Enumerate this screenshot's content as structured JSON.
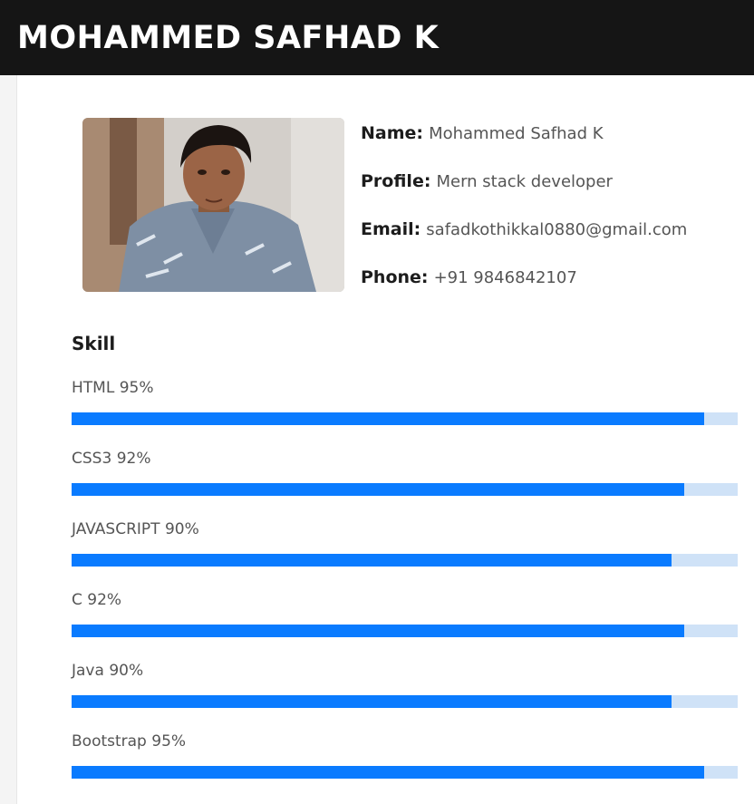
{
  "header": {
    "title": "MOHAMMED SAFHAD K"
  },
  "profile": {
    "photo_alt": "profile photo",
    "fields": [
      {
        "key": "Name:",
        "value": "Mohammed Safhad K"
      },
      {
        "key": "Profile:",
        "value": "Mern stack developer"
      },
      {
        "key": "Email:",
        "value": "safadkothikkal0880@gmail.com"
      },
      {
        "key": "Phone:",
        "value": "+91 9846842107"
      }
    ]
  },
  "skills": {
    "title": "Skill",
    "items": [
      {
        "name": "HTML",
        "percent_label": "95%",
        "percent": 95
      },
      {
        "name": "CSS3",
        "percent_label": "92%",
        "percent": 92
      },
      {
        "name": "JAVASCRIPT",
        "percent_label": "90%",
        "percent": 90
      },
      {
        "name": "C",
        "percent_label": "92%",
        "percent": 92
      },
      {
        "name": "Java",
        "percent_label": "90%",
        "percent": 90
      },
      {
        "name": "Bootstrap",
        "percent_label": "95%",
        "percent": 95
      }
    ]
  },
  "colors": {
    "header_bg": "#151515",
    "bar_fill": "#0a7bff",
    "bar_track": "#cfe2f7"
  }
}
